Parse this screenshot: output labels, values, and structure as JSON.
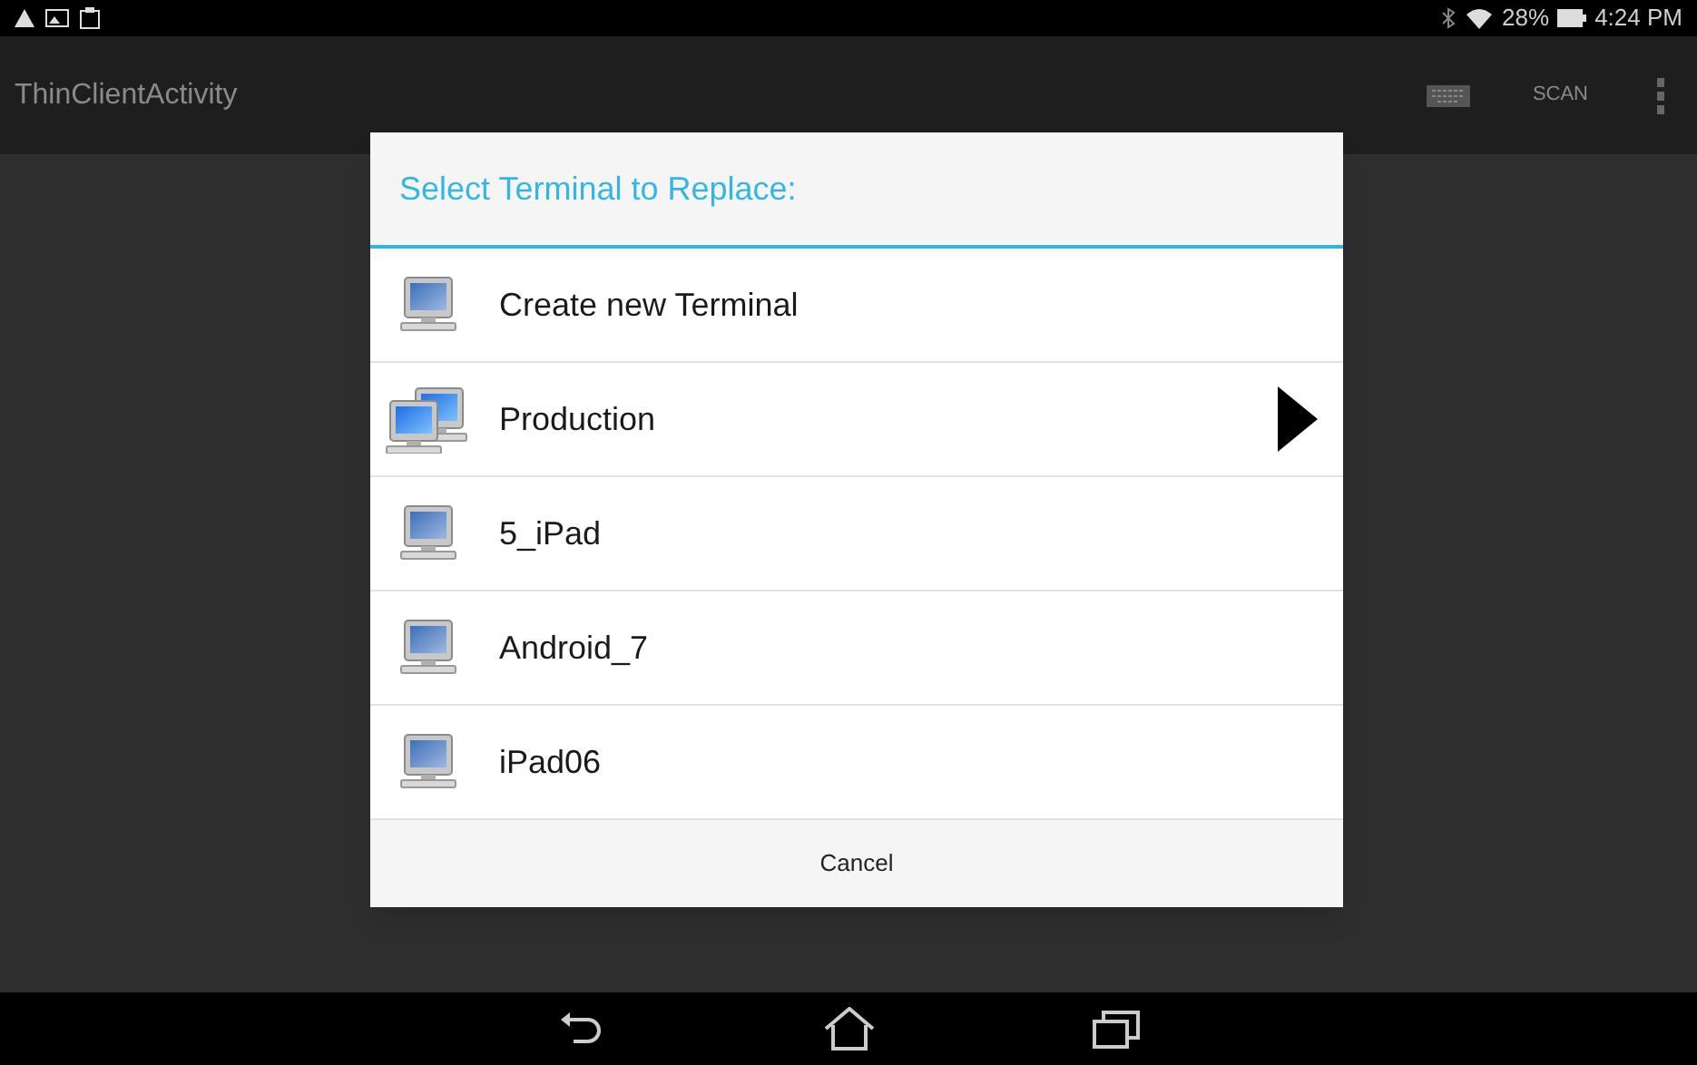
{
  "status_bar": {
    "battery": "28%",
    "time": "4:24 PM"
  },
  "action_bar": {
    "title": "ThinClientActivity",
    "scan": "SCAN"
  },
  "dialog": {
    "title": "Select Terminal to Replace:",
    "items": [
      {
        "label": "Create new Terminal",
        "kind": "single"
      },
      {
        "label": "Production",
        "kind": "group"
      },
      {
        "label": "5_iPad",
        "kind": "single"
      },
      {
        "label": "Android_7",
        "kind": "single"
      },
      {
        "label": "iPad06",
        "kind": "single"
      }
    ],
    "cancel": "Cancel"
  }
}
